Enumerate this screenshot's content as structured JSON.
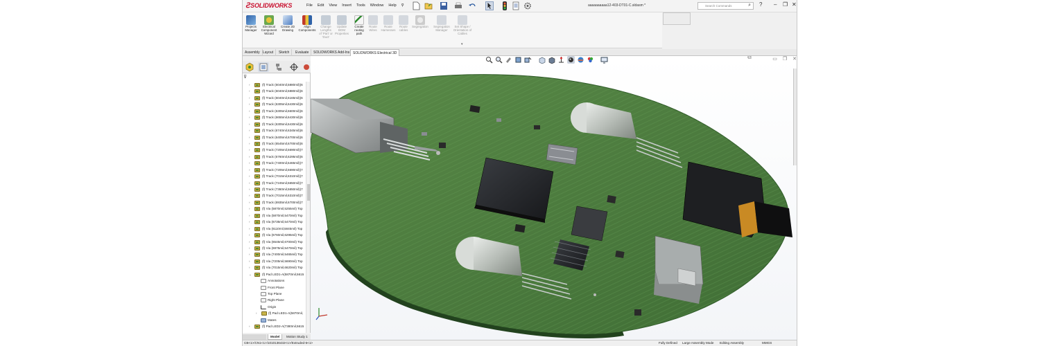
{
  "app": {
    "logo": "SOLIDWORKS",
    "document_title": "aaaaaaaaaa12-403-DT01-C.sldasm *",
    "menu": [
      "File",
      "Edit",
      "View",
      "Insert",
      "Tools",
      "Window",
      "Help"
    ],
    "search_placeholder": "Search Commands"
  },
  "command_manager": {
    "commands": [
      {
        "label": "Projects Manager",
        "enabled": true
      },
      {
        "label": "Electrical Component Wizard",
        "enabled": true
      },
      {
        "label": "Create 2D Drawing",
        "enabled": true
      },
      {
        "label": "Align Components",
        "enabled": true
      },
      {
        "label": "Change Lengths of 'Part' or 'Duct'",
        "enabled": false
      },
      {
        "label": "Update BOM Properties",
        "enabled": false
      },
      {
        "label": "Create routing path",
        "enabled": true
      },
      {
        "label": "Route Wires",
        "enabled": false
      },
      {
        "label": "Route Harnesses",
        "enabled": false
      },
      {
        "label": "Route cables",
        "enabled": false
      },
      {
        "label": "Segregation",
        "enabled": false
      },
      {
        "label": "Segregation Manager",
        "enabled": false
      },
      {
        "label": "Set Shape / Orientation of Cables",
        "enabled": false
      }
    ],
    "tabs": [
      "Assembly",
      "Layout",
      "Sketch",
      "Evaluate",
      "SOLIDWORKS Add-Ins",
      "SOLIDWORKS Electrical 3D"
    ],
    "active_tab": "SOLIDWORKS Electrical 3D"
  },
  "feature_tree": {
    "items": [
      {
        "label": "(f) Track (6040mil,5880mil)(6",
        "kind": "track"
      },
      {
        "label": "(f) Track (6040mil,5880mil)(6",
        "kind": "track"
      },
      {
        "label": "(f) Track (6040mil,6165mil)(6",
        "kind": "track"
      },
      {
        "label": "(f) Track (6305mil,6430mil)(6",
        "kind": "track"
      },
      {
        "label": "(f) Track (6305mil,6600mil)(6",
        "kind": "track"
      },
      {
        "label": "(f) Track (6655mil,6430mil)(6",
        "kind": "track"
      },
      {
        "label": "(f) Track (6305mil,6430mil)(6",
        "kind": "track"
      },
      {
        "label": "(f) Track (6740mil,6345mil)(6",
        "kind": "track"
      },
      {
        "label": "(f) Track (6405mil,6700mil)(6",
        "kind": "track"
      },
      {
        "label": "(f) Track (6545mil,6700mil)(6",
        "kind": "track"
      },
      {
        "label": "(f) Track (7205mil,5690mil)(7",
        "kind": "track"
      },
      {
        "label": "(f) Track (6760mil,6295mil)(6",
        "kind": "track"
      },
      {
        "label": "(f) Track (7400mil,5465mil)(7",
        "kind": "track"
      },
      {
        "label": "(f) Track (7205mil,5690mil)(7",
        "kind": "track"
      },
      {
        "label": "(f) Track (7015mil,6310mil)(7",
        "kind": "track"
      },
      {
        "label": "(f) Track (7245mil,5650mil)(7",
        "kind": "track"
      },
      {
        "label": "(f) Track (7360mil,5650mil)(7",
        "kind": "track"
      },
      {
        "label": "(f) Track (7015mil,6310mil)(7",
        "kind": "track"
      },
      {
        "label": "(f) Track (6935mil,6700mil)(7",
        "kind": "track"
      },
      {
        "label": "(f) Via (5870mil,5255mil) Top",
        "kind": "via"
      },
      {
        "label": "(f) Via (5870mil,5470mil) Top",
        "kind": "via"
      },
      {
        "label": "(f) Via (6735mil,5470mil) Top",
        "kind": "via"
      },
      {
        "label": "(f) Via (6110mil,5845mil) Top",
        "kind": "via"
      },
      {
        "label": "(f) Via (6760mil,6295mil) Top",
        "kind": "via"
      },
      {
        "label": "(f) Via (6545mil,6700mil) Top",
        "kind": "via"
      },
      {
        "label": "(f) Via (6975mil,5470mil) Top",
        "kind": "via"
      },
      {
        "label": "(f) Via (7400mil,5465mil) Top",
        "kind": "via"
      },
      {
        "label": "(f) Via (7205mil,5690mil) Top",
        "kind": "via"
      },
      {
        "label": "(f) Via (7015mil,6620mil) Top",
        "kind": "via"
      },
      {
        "label": "(f) Pad LED1-A(5870mil,5615",
        "kind": "pad-expanded"
      },
      {
        "label": "Annotations",
        "kind": "sub"
      },
      {
        "label": "Front Plane",
        "kind": "sub"
      },
      {
        "label": "Top Plane",
        "kind": "sub"
      },
      {
        "label": "Right Plane",
        "kind": "sub"
      },
      {
        "label": "Origin",
        "kind": "origin"
      },
      {
        "label": "(f) Pad LED1-A(5870mil,",
        "kind": "subpad"
      },
      {
        "label": "Mates",
        "kind": "mates"
      },
      {
        "label": "(f) Pad LED2-A(7380mil,5615",
        "kind": "track"
      }
    ],
    "bottom_tabs": [
      "",
      "Model",
      "Motion Study 1"
    ],
    "active_bottom_tab": "Model"
  },
  "status_bar": {
    "path": "CB<1>/CN1<1>/1010136432<1>/Extruded-5<1>",
    "defined": "Fully Defined",
    "mode": "Large Assembly Mode",
    "editing": "Editing Assembly",
    "units": "MMGS"
  },
  "colors": {
    "accent": "#c8102e",
    "pcb_board": "#4a7a3e",
    "pcb_dark": "#2f5a28",
    "chip": "#222326",
    "connector_orange": "#c98a24"
  }
}
